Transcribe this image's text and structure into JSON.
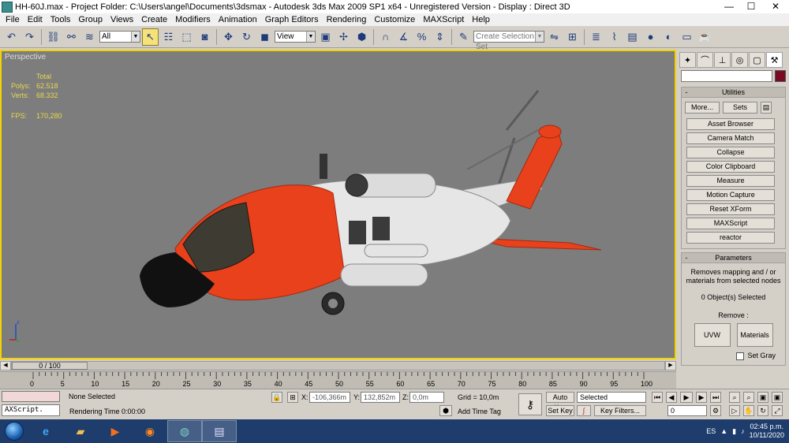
{
  "window": {
    "title": "HH-60J.max    - Project Folder: C:\\Users\\angel\\Documents\\3dsmax    - Autodesk 3ds Max  2009 SP1  x64    - Unregistered Version    - Display : Direct 3D",
    "minimize": "—",
    "maximize": "☐",
    "close": "✕"
  },
  "menu": [
    "File",
    "Edit",
    "Tools",
    "Group",
    "Views",
    "Create",
    "Modifiers",
    "Animation",
    "Graph Editors",
    "Rendering",
    "Customize",
    "MAXScript",
    "Help"
  ],
  "toolbar": {
    "filter_value": "All",
    "ref_coord_value": "View",
    "named_selection_placeholder": "Create Selection Set"
  },
  "viewport": {
    "label": "Perspective",
    "stats": {
      "header": "Total",
      "polys_label": "Polys:",
      "polys_value": "62.518",
      "verts_label": "Verts:",
      "verts_value": "68.332",
      "fps_label": "FPS:",
      "fps_value": "170,280"
    },
    "axis_z": "z"
  },
  "command_panel": {
    "utilities": {
      "title": "Utilities",
      "more_label": "More...",
      "sets_label": "Sets",
      "items": [
        "Asset Browser",
        "Camera Match",
        "Collapse",
        "Color Clipboard",
        "Measure",
        "Motion Capture",
        "Reset XForm",
        "MAXScript",
        "reactor"
      ]
    },
    "parameters": {
      "title": "Parameters",
      "description": "Removes mapping and / or materials from selected nodes",
      "selected": "0 Object(s) Selected",
      "remove_label": "Remove :",
      "uvw_label": "UVW",
      "materials_label": "Materials",
      "set_gray_label": "Set Gray"
    }
  },
  "timeline": {
    "frame_display": "0 / 100",
    "ticks": [
      "0",
      "5",
      "10",
      "15",
      "20",
      "25",
      "30",
      "35",
      "40",
      "45",
      "50",
      "55",
      "60",
      "65",
      "70",
      "75",
      "80",
      "85",
      "90",
      "95",
      "100"
    ]
  },
  "status": {
    "listener_text": "AXScript.",
    "selection": "None Selected",
    "rendering_time": "Rendering Time  0:00:00",
    "x_label": "X:",
    "x_value": "-106,366m",
    "y_label": "Y:",
    "y_value": "132,852m",
    "z_label": "Z:",
    "z_value": "0,0m",
    "grid": "Grid = 10,0m",
    "add_time_tag": "Add Time Tag",
    "auto_key": "Auto Key",
    "set_key": "Set Key",
    "key_mode_value": "Selected",
    "key_filters": "Key Filters...",
    "current_frame": "0"
  },
  "taskbar": {
    "language": "ES",
    "time": "02:45 p.m.",
    "date": "10/11/2020"
  },
  "colors": {
    "viewport_bg": "#7d7d7d",
    "active_border": "#f5d300",
    "stats_text": "#e8d84a",
    "heli_orange": "#e8411c",
    "heli_white": "#e6e6e6"
  }
}
